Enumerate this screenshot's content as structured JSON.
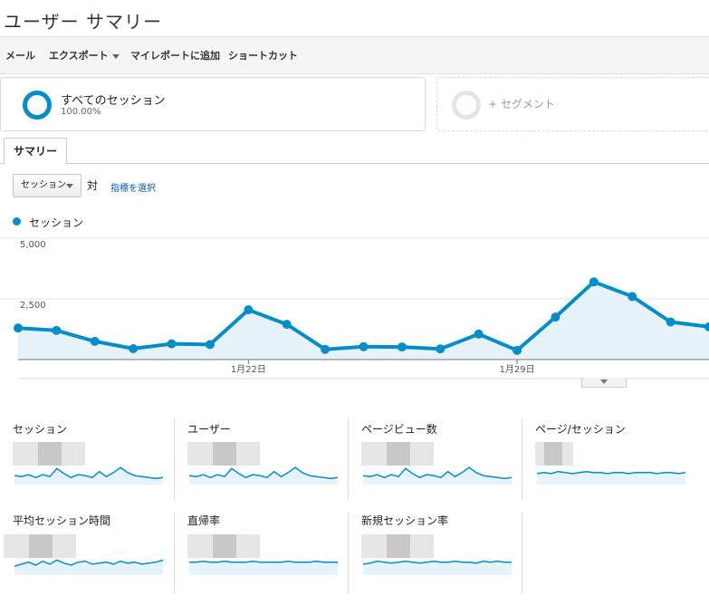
{
  "header": {
    "title": "ユーザー サマリー"
  },
  "toolbar": {
    "mail": "メール",
    "export": "エクスポート",
    "add_dashboard": "マイレポートに追加",
    "shortcut": "ショートカット"
  },
  "segments": {
    "active": {
      "name": "すべてのセッション",
      "percent": "100.00%"
    },
    "add": "+ セグメント"
  },
  "tabs": {
    "summary": "サマリー"
  },
  "controls": {
    "metric": "セッション",
    "vs": "対",
    "pick": "指標を選択"
  },
  "legend": {
    "series": "セッション"
  },
  "colors": {
    "accent": "#058dc7",
    "fill": "#e6f3fa",
    "blur_light": "#e6e6e6",
    "blur_dark": "#c8c8c8"
  },
  "chart_data": {
    "type": "area",
    "series": [
      {
        "name": "セッション",
        "values": [
          1300,
          1200,
          750,
          450,
          650,
          620,
          2050,
          1450,
          420,
          530,
          520,
          440,
          1050,
          380,
          1750,
          3200,
          2600,
          1550,
          1350
        ]
      }
    ],
    "ylim": [
      0,
      5000
    ],
    "y_ticks": [
      {
        "value": 5000,
        "label": "5,000"
      },
      {
        "value": 2500,
        "label": "2,500"
      }
    ],
    "x_ticks": [
      {
        "index": 6,
        "label": "1月22日"
      },
      {
        "index": 13,
        "label": "1月29日"
      }
    ]
  },
  "metrics": [
    {
      "label": "セッション",
      "spark": [
        8,
        7,
        9,
        6,
        9,
        7,
        15,
        10,
        6,
        9,
        8,
        6,
        12,
        7,
        11,
        16,
        11,
        8,
        7,
        6,
        5,
        6
      ]
    },
    {
      "label": "ユーザー",
      "spark": [
        8,
        7,
        9,
        6,
        9,
        7,
        15,
        10,
        6,
        9,
        8,
        6,
        12,
        7,
        11,
        16,
        11,
        8,
        7,
        6,
        5,
        6
      ]
    },
    {
      "label": "ページビュー数",
      "spark": [
        8,
        7,
        9,
        6,
        9,
        7,
        15,
        10,
        6,
        9,
        8,
        6,
        12,
        7,
        11,
        16,
        11,
        8,
        7,
        6,
        5,
        6
      ]
    },
    {
      "label": "ページ/セッション",
      "spark": [
        10,
        11,
        10,
        12,
        11,
        10,
        11,
        12,
        11,
        11,
        10,
        11,
        11,
        10,
        11,
        11,
        11,
        10,
        11,
        11,
        10,
        11
      ]
    },
    {
      "label": "平均セッション時間",
      "spark": [
        8,
        10,
        12,
        9,
        13,
        10,
        14,
        11,
        9,
        12,
        13,
        10,
        11,
        12,
        10,
        13,
        11,
        12,
        10,
        11,
        12,
        14
      ]
    },
    {
      "label": "直帰率",
      "spark": [
        12,
        12,
        13,
        12,
        12,
        13,
        12,
        12,
        12,
        13,
        12,
        12,
        12,
        12,
        13,
        12,
        12,
        12,
        13,
        12,
        12,
        12
      ]
    },
    {
      "label": "新規セッション率",
      "spark": [
        10,
        11,
        13,
        12,
        11,
        12,
        13,
        12,
        11,
        12,
        13,
        12,
        12,
        13,
        12,
        12,
        11,
        13,
        12,
        13,
        12,
        12
      ]
    }
  ]
}
